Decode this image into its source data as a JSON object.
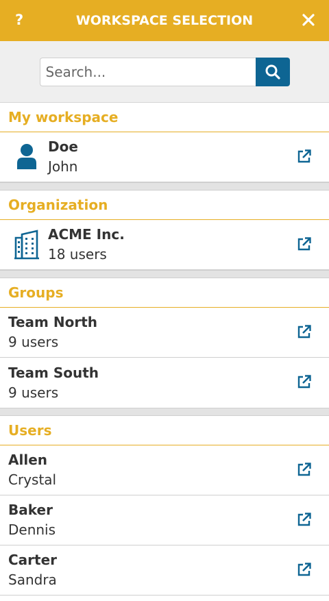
{
  "header": {
    "help_label": "?",
    "title": "WORKSPACE SELECTION"
  },
  "search": {
    "placeholder": "Search...",
    "value": ""
  },
  "sections": {
    "my_workspace": {
      "label": "My workspace",
      "items": [
        {
          "primary": "Doe",
          "secondary": "John",
          "icon": "user-icon"
        }
      ]
    },
    "organization": {
      "label": "Organization",
      "items": [
        {
          "primary": "ACME Inc.",
          "secondary": "18 users",
          "icon": "building-icon"
        }
      ]
    },
    "groups": {
      "label": "Groups",
      "items": [
        {
          "primary": "Team North",
          "secondary": "9 users"
        },
        {
          "primary": "Team South",
          "secondary": "9 users"
        }
      ]
    },
    "users": {
      "label": "Users",
      "items": [
        {
          "primary": "Allen",
          "secondary": "Crystal"
        },
        {
          "primary": "Baker",
          "secondary": "Dennis"
        },
        {
          "primary": "Carter",
          "secondary": "Sandra"
        }
      ]
    }
  },
  "colors": {
    "accent": "#e6ae23",
    "primary_blue": "#0e6593",
    "text": "#333333",
    "divider": "#cfcfcf"
  }
}
